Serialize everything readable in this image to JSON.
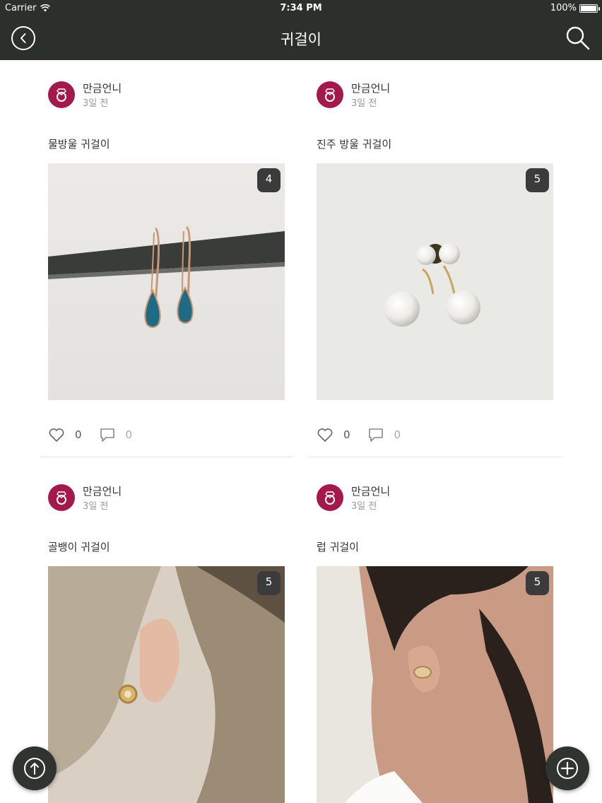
{
  "status_bar": {
    "carrier": "Carrier",
    "time": "7:34 PM",
    "battery": "100%"
  },
  "header": {
    "title": "귀걸이",
    "back_icon": "chevron-left-circle-icon",
    "search_icon": "search-icon"
  },
  "colors": {
    "header_bg": "#2b302c",
    "avatar_bg": "#a3194c",
    "badge_bg": "#3b3b3b",
    "fab_bg": "#2f3430"
  },
  "posts": [
    {
      "author": "만금언니",
      "time": "3일 전",
      "title": "물방울 귀걸이",
      "image_count": "4",
      "likes": "0",
      "comments": "0"
    },
    {
      "author": "만금언니",
      "time": "3일 전",
      "title": "진주 방울 귀걸이",
      "image_count": "5",
      "likes": "0",
      "comments": "0"
    },
    {
      "author": "만금언니",
      "time": "3일 전",
      "title": "골뱅이 귀걸이",
      "image_count": "5",
      "likes": "",
      "comments": ""
    },
    {
      "author": "만금언니",
      "time": "3일 전",
      "title": "럽 귀걸이",
      "image_count": "5",
      "likes": "",
      "comments": ""
    }
  ],
  "fabs": {
    "scroll_top_icon": "arrow-up-circle-icon",
    "add_icon": "plus-circle-icon"
  }
}
